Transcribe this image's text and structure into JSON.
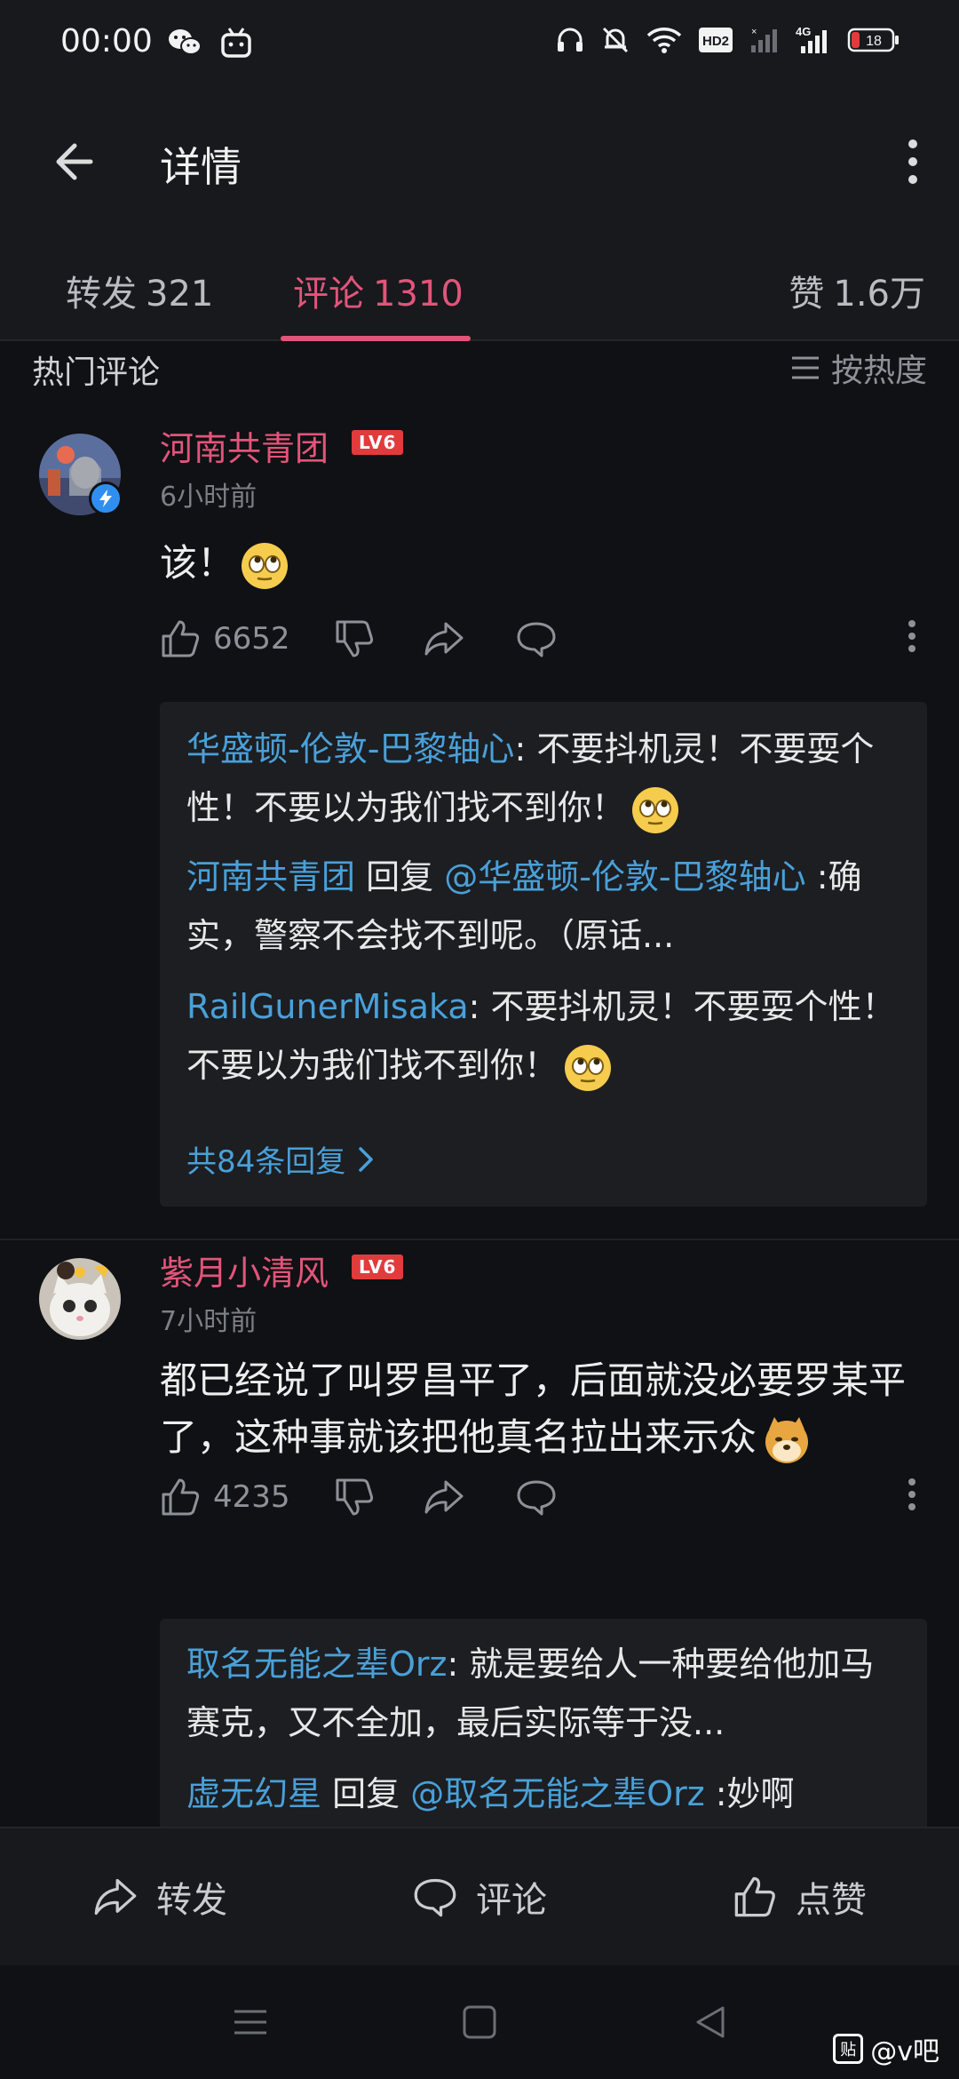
{
  "status_bar": {
    "time": "00:00",
    "hd_label": "HD2",
    "network": "4G",
    "battery": "18"
  },
  "app_bar": {
    "title": "详情"
  },
  "tabs": [
    {
      "label": "转发",
      "count": "321"
    },
    {
      "label": "评论",
      "count": "1310"
    },
    {
      "label": "赞",
      "count": "1.6万"
    }
  ],
  "section": {
    "title": "热门评论",
    "sort_label": "按热度"
  },
  "comments": [
    {
      "username": "河南共青团",
      "level": "LV6",
      "time": "6小时前",
      "text": "该！",
      "likes": "6652",
      "replies": [
        {
          "name": "华盛顿-伦敦-巴黎轴心",
          "text": ": 不要抖机灵！不要耍个性！不要以为我们找不到你！"
        },
        {
          "name": "河南共青团",
          "reply_word": " 回复 ",
          "target": "@华盛顿-伦敦-巴黎轴心",
          "text": " :确实，警察不会找不到呢。（原话..."
        },
        {
          "name": "RailGunerMisaka",
          "text": ": 不要抖机灵！不要耍个性！不要以为我们找不到你！"
        }
      ],
      "more_replies": "共84条回复"
    },
    {
      "username": "紫月小清风",
      "level": "LV6",
      "time": "7小时前",
      "text": "都已经说了叫罗昌平了，后面就没必要罗某平了，这种事就该把他真名拉出来示众",
      "likes": "4235",
      "replies": [
        {
          "name": "取名无能之辈Orz",
          "text": ": 就是要给人一种要给他加马赛克，又不全加，最后实际等于没..."
        },
        {
          "name": "虚无幻星",
          "reply_word": " 回复 ",
          "target": "@取名无能之辈Orz",
          "text": " :妙啊"
        }
      ]
    }
  ],
  "bottom_bar": {
    "forward": "转发",
    "comment": "评论",
    "like": "点赞"
  },
  "watermark": {
    "box": "贴",
    "text": "@v吧"
  },
  "colors": {
    "accent": "#e2557a",
    "link": "#4aa0d8",
    "background": "#0f1114"
  }
}
